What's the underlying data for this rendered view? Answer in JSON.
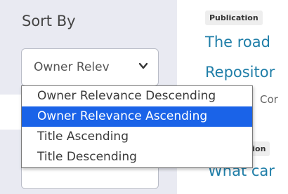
{
  "sidebar": {
    "title": "Sort By",
    "select": {
      "value": "Owner Relev",
      "icon": "chevron-down-icon"
    },
    "options": [
      {
        "label": "Owner Relevance Descending",
        "selected": false
      },
      {
        "label": "Owner Relevance Ascending",
        "selected": true
      },
      {
        "label": "Title Ascending",
        "selected": false
      },
      {
        "label": "Title Descending",
        "selected": false
      }
    ]
  },
  "results": [
    {
      "badge": "Publication",
      "title_line1": "The road",
      "title_line2": "Repositor",
      "meta": "Cor"
    },
    {
      "badge": "tion",
      "title_line1": "What car"
    }
  ],
  "colors": {
    "highlight": "#1a63e8",
    "link": "#1f7ea8",
    "panel": "#e9eaf2"
  }
}
